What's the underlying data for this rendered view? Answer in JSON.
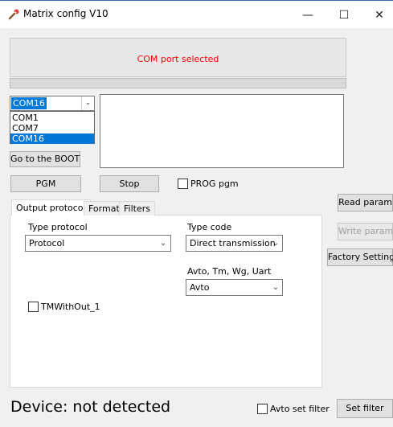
{
  "window": {
    "title": "Matrix config V10",
    "minimize_glyph": "—",
    "maximize_glyph": "☐",
    "close_glyph": "✕"
  },
  "status": {
    "message": "COM port selected",
    "message_color": "#ff0000",
    "progress_fraction": 0.0
  },
  "com_port": {
    "selected": "COM16",
    "options": [
      "COM1",
      "COM7",
      "COM16"
    ]
  },
  "buttons": {
    "goto_boot": "Go to the BOOT",
    "pgm": "PGM",
    "stop": "Stop",
    "read_param": "Read param",
    "write_param": "Write param",
    "factory_settings": "Factory Settings",
    "set_filter": "Set filter"
  },
  "checkboxes": {
    "prog_pgm": {
      "label": "PROG pgm",
      "checked": false
    },
    "tm_without": {
      "label": "TMWithOut_1",
      "checked": false
    },
    "avto_set_filter": {
      "label": "Avto set filter",
      "checked": false
    }
  },
  "tabs": [
    {
      "label": "Output protocol",
      "active": true
    },
    {
      "label": "Format",
      "active": false
    },
    {
      "label": "Filters",
      "active": false
    }
  ],
  "output_protocol": {
    "type_protocol_label": "Type protocol",
    "type_protocol_value": "Protocol",
    "type_code_label": "Type code",
    "type_code_value": "Direct transmission",
    "avto_label": "Avto, Tm, Wg, Uart",
    "avto_value": "Avto"
  },
  "device_status": "Device: not detected",
  "icons": {
    "app": "wrench-icon",
    "dropdown": "chevron-down-icon"
  },
  "colors": {
    "selection_blue": "#0078d7",
    "status_red": "#ff0000"
  }
}
